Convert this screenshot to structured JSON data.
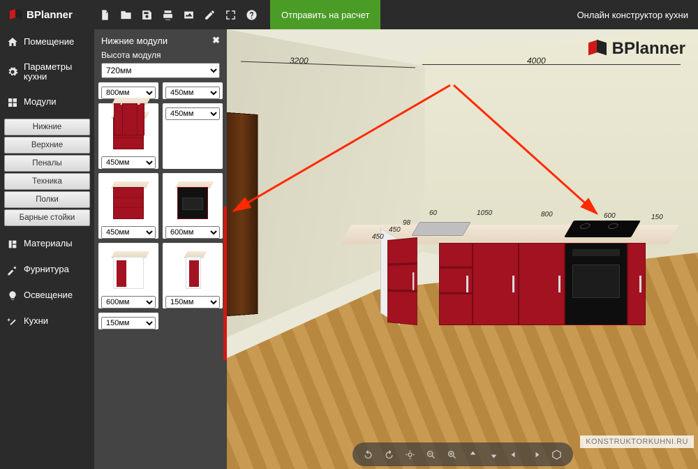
{
  "app": {
    "name": "BPlanner",
    "title_right": "Онлайн конструктор кухни",
    "viewport_logo": "BPlanner"
  },
  "toolbar": {
    "icons": [
      "new-file",
      "open-folder",
      "save",
      "print",
      "image",
      "edit",
      "fullscreen",
      "help"
    ],
    "send_label": "Отправить на расчет"
  },
  "sidebar": {
    "room": "Помещение",
    "params": "Параметры кухни",
    "modules": "Модули",
    "sub": [
      "Нижние",
      "Верхние",
      "Пеналы",
      "Техника",
      "Полки",
      "Барные стойки"
    ],
    "materials": "Материалы",
    "hardware": "Фурнитура",
    "lighting": "Освещение",
    "kitchens": "Кухни"
  },
  "panel": {
    "title": "Нижние модули",
    "height_label": "Высота модуля",
    "height_value": "720мм",
    "items": [
      {
        "size": "800мм",
        "kind": "cab"
      },
      {
        "size": "450мм",
        "kind": "cab"
      },
      {
        "size": "450мм",
        "kind": "drawer"
      },
      {
        "size": "450мм",
        "kind": "cab"
      },
      {
        "size": "450мм",
        "kind": "drawer"
      },
      {
        "size": "600мм",
        "kind": "oven"
      },
      {
        "size": "600мм",
        "kind": "open"
      },
      {
        "size": "150мм",
        "kind": "narrow open"
      },
      {
        "size": "150мм",
        "kind": "narrow cab"
      }
    ]
  },
  "scene": {
    "dims_top": [
      "3200",
      "4000"
    ],
    "dims_counter": [
      "60",
      "1050",
      "800",
      "600",
      "150"
    ],
    "dims_side": [
      "450",
      "98",
      "450"
    ],
    "watermark": "KONSTRUKTORKUHNI.RU"
  },
  "bottom_tools": [
    "rotate-left",
    "rotate-right",
    "target",
    "zoom-out",
    "zoom-in",
    "pan-up",
    "pan-down",
    "pan-left",
    "pan-right",
    "view-3d"
  ]
}
